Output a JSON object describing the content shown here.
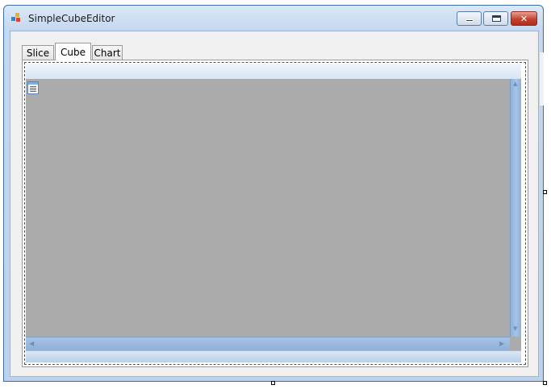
{
  "window": {
    "title": "SimpleCubeEditor",
    "controls": {
      "minimize": "minimize",
      "maximize": "maximize",
      "close": "close"
    },
    "close_glyph": "✕"
  },
  "tabs": [
    {
      "label": "Slice",
      "selected": false
    },
    {
      "label": "Cube",
      "selected": true
    },
    {
      "label": "Chart",
      "selected": false
    }
  ],
  "colors": {
    "mdi_background": "#ababab",
    "scrollbar": "#8fb0d8",
    "toolbar": "#e4edf8",
    "close_button": "#c2422f"
  },
  "icons": {
    "app": "app-icon",
    "document": "document-icon",
    "scroll_up": "▲",
    "scroll_down": "▼",
    "scroll_left": "◀",
    "scroll_right": "▶"
  }
}
